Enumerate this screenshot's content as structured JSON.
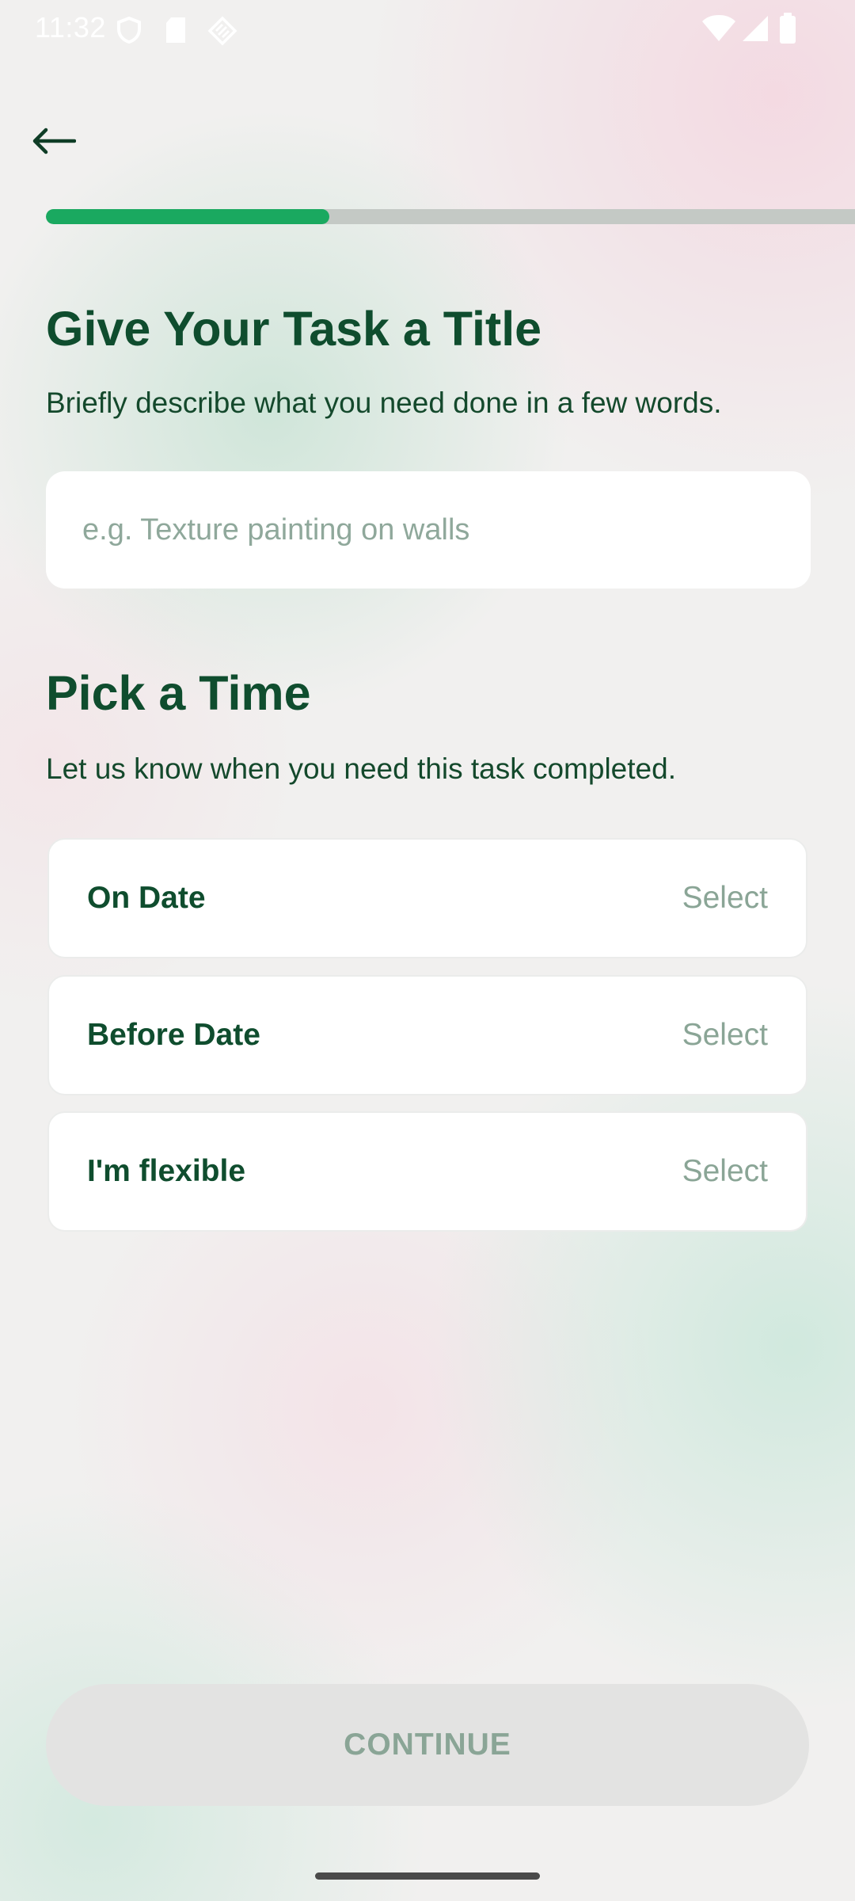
{
  "status_bar": {
    "time": "11:32",
    "left_icons": [
      "shield-icon",
      "sd-card-icon",
      "diamond-grid-icon"
    ],
    "right_icons": [
      "wifi-icon",
      "signal-icon",
      "battery-icon"
    ]
  },
  "navigation": {
    "back_icon": "arrow-left-icon"
  },
  "progress": {
    "fraction": 0.35,
    "fill_color": "#1aa960",
    "track_color": "#c4c9c5"
  },
  "title_section": {
    "heading": "Give Your Task a Title",
    "description": "Briefly describe what you need done in a few words.",
    "input_value": "",
    "input_placeholder": "e.g. Texture painting on walls"
  },
  "time_section": {
    "heading": "Pick a Time",
    "description": "Let us know when you need this task completed.",
    "options": [
      {
        "label": "On Date",
        "action": "Select"
      },
      {
        "label": "Before Date",
        "action": "Select"
      },
      {
        "label": "I'm flexible",
        "action": "Select"
      }
    ]
  },
  "footer": {
    "continue_label": "CONTINUE"
  },
  "colors": {
    "heading": "#0f4d2e",
    "muted": "#8aa596",
    "accent": "#1aa960"
  }
}
